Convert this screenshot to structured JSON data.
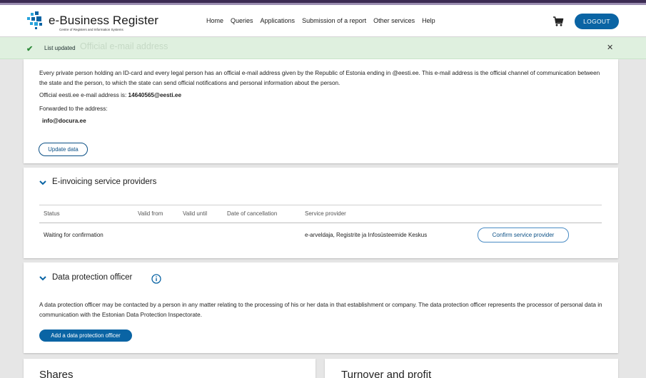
{
  "header": {
    "logo_title": "e-Business Register",
    "logo_subtitle": "Centre of Registers and Information Systems",
    "nav": [
      "Home",
      "Queries",
      "Applications",
      "Submission of a report",
      "Other services",
      "Help"
    ],
    "logout_label": "LOGOUT"
  },
  "toast": {
    "message": "List updated",
    "background_text": "Official e-mail address"
  },
  "email_section": {
    "intro": "Every private person holding an ID-card and every legal person has an official e-mail address given by the Republic of Estonia ending in @eesti.ee. This e-mail address is the official channel of communication between the state and the person, to which the state can send official notifications and personal information about the person.",
    "official_label": "Official eesti.ee e-mail address is:",
    "official_value": "14640565@eesti.ee",
    "forwarded_label": "Forwarded to the address:",
    "forwarded_value": "info@docura.ee",
    "update_label": "Update data"
  },
  "einvoicing": {
    "title": "E-invoicing service providers",
    "columns": [
      "Status",
      "Valid from",
      "Valid until",
      "Date of cancellation",
      "Service provider"
    ],
    "rows": [
      {
        "status": "Waiting for confirmation",
        "valid_from": "",
        "valid_until": "",
        "cancellation": "",
        "provider": "e-arveldaja, Registrite ja Infosüsteemide Keskus",
        "action": "Confirm service provider"
      }
    ]
  },
  "dpo": {
    "title": "Data protection officer",
    "text": "A data protection officer may be contacted by a person in any matter relating to the processing of his or her data in that establishment or company. The data protection officer represents the processor of personal data in communication with the Estonian Data Protection Inspectorate.",
    "add_label": "Add a data protection officer"
  },
  "bottom": {
    "shares_title": "Shares",
    "turnover_title": "Turnover and profit"
  },
  "colors": {
    "accent": "#0a64a4",
    "toast_bg": "#dff0df",
    "stripe": "#3b2b52"
  }
}
